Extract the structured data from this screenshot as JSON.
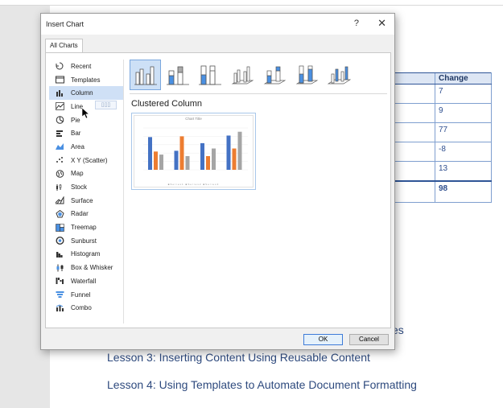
{
  "document": {
    "table": {
      "header": "Change",
      "values": [
        "7",
        "9",
        "77",
        "-8",
        "13"
      ],
      "total": "98"
    },
    "lessons": [
      "Lesson 3: Inserting Content Using Reusable Content",
      "Lesson 4: Using Templates to Automate Document Formatting"
    ],
    "partial_text": "es"
  },
  "dialog": {
    "title": "Insert Chart",
    "help_label": "?",
    "close_label": "✕",
    "tab_label": "All Charts",
    "chart_types": [
      {
        "label": "Recent",
        "icon": "recent-icon"
      },
      {
        "label": "Templates",
        "icon": "templates-icon"
      },
      {
        "label": "Column",
        "icon": "column-chart-icon",
        "selected": true
      },
      {
        "label": "Line",
        "icon": "line-chart-icon"
      },
      {
        "label": "Pie",
        "icon": "pie-chart-icon"
      },
      {
        "label": "Bar",
        "icon": "bar-chart-icon"
      },
      {
        "label": "Area",
        "icon": "area-chart-icon"
      },
      {
        "label": "X Y (Scatter)",
        "icon": "scatter-chart-icon"
      },
      {
        "label": "Map",
        "icon": "map-chart-icon"
      },
      {
        "label": "Stock",
        "icon": "stock-chart-icon"
      },
      {
        "label": "Surface",
        "icon": "surface-chart-icon"
      },
      {
        "label": "Radar",
        "icon": "radar-chart-icon"
      },
      {
        "label": "Treemap",
        "icon": "treemap-chart-icon"
      },
      {
        "label": "Sunburst",
        "icon": "sunburst-chart-icon"
      },
      {
        "label": "Histogram",
        "icon": "histogram-chart-icon"
      },
      {
        "label": "Box & Whisker",
        "icon": "box-whisker-chart-icon"
      },
      {
        "label": "Waterfall",
        "icon": "waterfall-chart-icon"
      },
      {
        "label": "Funnel",
        "icon": "funnel-chart-icon"
      },
      {
        "label": "Combo",
        "icon": "combo-chart-icon"
      }
    ],
    "subtype_name": "Clustered Column",
    "preview": {
      "title": "Chart Title",
      "legend": "■Series1 ■Series2 ■Series3",
      "colors": [
        "#4472c4",
        "#ed7d31",
        "#a5a5a5"
      ],
      "series": [
        {
          "values": [
            4.3,
            2.4,
            2.0
          ]
        },
        {
          "values": [
            2.5,
            4.4,
            1.8
          ]
        },
        {
          "values": [
            3.5,
            1.8,
            2.8
          ]
        },
        {
          "values": [
            4.5,
            2.8,
            5.0
          ]
        }
      ]
    },
    "ok_label": "OK",
    "cancel_label": "Cancel",
    "tooltip_text": "▯▯▯"
  }
}
